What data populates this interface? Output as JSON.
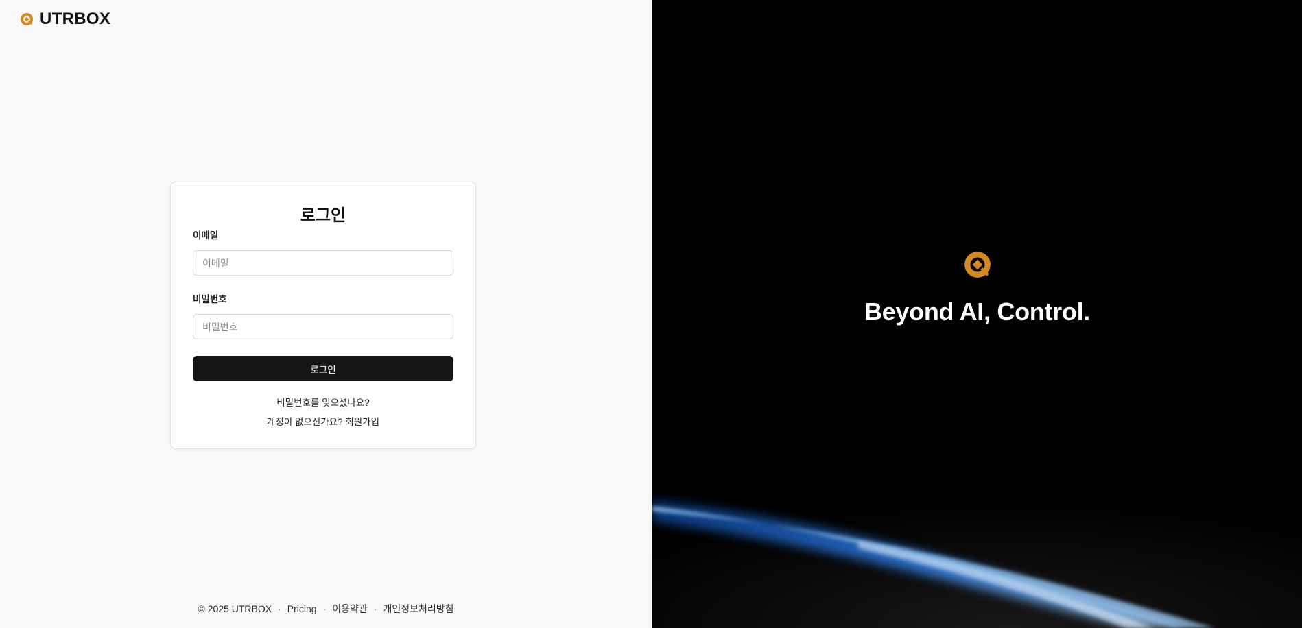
{
  "brand": {
    "name": "UTRBOX",
    "logo_icon": "utrbox-logo-icon",
    "accent_color": "#D38A22"
  },
  "login_card": {
    "title": "로그인",
    "email": {
      "label": "이메일",
      "placeholder": "이메일",
      "value": ""
    },
    "password": {
      "label": "비밀번호",
      "placeholder": "비밀번호",
      "value": ""
    },
    "submit_label": "로그인",
    "forgot_password": "비밀번호를 잊으셨나요?",
    "signup": "계정이 없으신가요? 회원가입"
  },
  "footer": {
    "copyright": "© 2025 UTRBOX",
    "separator": "·",
    "links": [
      "Pricing",
      "이용약관",
      "개인정보처리방침"
    ]
  },
  "hero": {
    "logo_icon": "utrbox-logo-icon",
    "tagline": "Beyond AI, Control.",
    "background_color": "#000000",
    "glow_color": "#2F7FE8"
  }
}
